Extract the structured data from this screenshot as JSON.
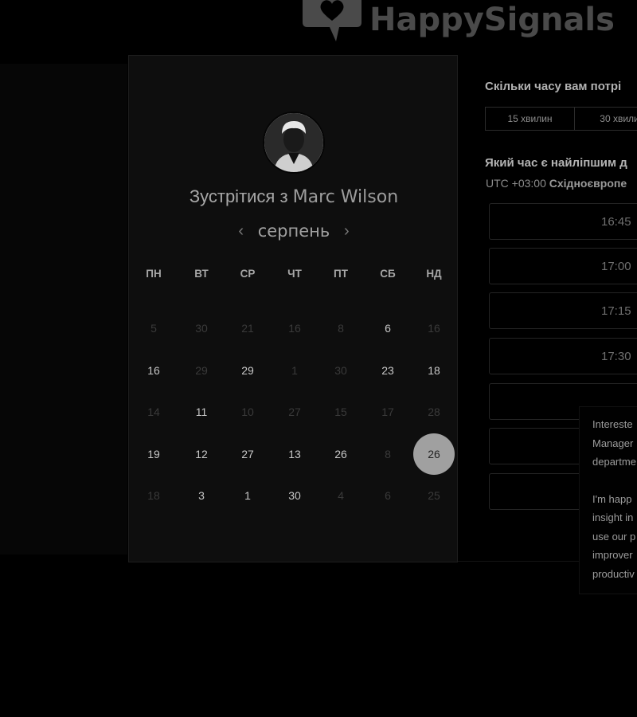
{
  "header": {
    "logo_text": "HappySignals"
  },
  "calendar": {
    "meet_prefix": "Зустрітися з ",
    "meet_name": "Marc Wilson",
    "month": "серпень",
    "weekdays": [
      "ПН",
      "ВТ",
      "СР",
      "ЧТ",
      "ПТ",
      "СБ",
      "НД"
    ],
    "weeks": [
      [
        {
          "d": "5",
          "s": "dim"
        },
        {
          "d": "30",
          "s": "dim"
        },
        {
          "d": "21",
          "s": "dim"
        },
        {
          "d": "16",
          "s": "dim"
        },
        {
          "d": "8",
          "s": "dim"
        },
        {
          "d": "6",
          "s": "on"
        },
        {
          "d": "16",
          "s": "dim"
        }
      ],
      [
        {
          "d": "16",
          "s": "on"
        },
        {
          "d": "29",
          "s": "dim"
        },
        {
          "d": "29",
          "s": "on"
        },
        {
          "d": "1",
          "s": "dim"
        },
        {
          "d": "30",
          "s": "dim"
        },
        {
          "d": "23",
          "s": "on"
        },
        {
          "d": "18",
          "s": "on"
        }
      ],
      [
        {
          "d": "14",
          "s": "dim"
        },
        {
          "d": "11",
          "s": "on"
        },
        {
          "d": "10",
          "s": "dim"
        },
        {
          "d": "27",
          "s": "dim"
        },
        {
          "d": "15",
          "s": "dim"
        },
        {
          "d": "17",
          "s": "dim"
        },
        {
          "d": "28",
          "s": "dim"
        }
      ],
      [
        {
          "d": "19",
          "s": "on"
        },
        {
          "d": "12",
          "s": "on"
        },
        {
          "d": "27",
          "s": "on"
        },
        {
          "d": "13",
          "s": "on"
        },
        {
          "d": "26",
          "s": "on"
        },
        {
          "d": "8",
          "s": "dim"
        },
        {
          "d": "26",
          "s": "sel"
        }
      ],
      [
        {
          "d": "18",
          "s": "dim"
        },
        {
          "d": "3",
          "s": "on"
        },
        {
          "d": "1",
          "s": "on"
        },
        {
          "d": "30",
          "s": "on"
        },
        {
          "d": "4",
          "s": "dim"
        },
        {
          "d": "6",
          "s": "dim"
        },
        {
          "d": "25",
          "s": "dim"
        }
      ]
    ]
  },
  "booking": {
    "duration_question": "Скільки часу вам потрі",
    "durations": [
      "15 хвилин",
      "30 хвили"
    ],
    "time_question": "Який час є найліпшим д",
    "timezone_prefix": "UTC +03:00 ",
    "timezone_name": "Східноєвропе",
    "slots": [
      "16:45",
      "17:00",
      "17:15",
      "17:30",
      "",
      "",
      ""
    ]
  },
  "promo": {
    "lines_1": [
      "Intereste",
      "Manager",
      "departme"
    ],
    "lines_2": [
      "I'm happ",
      "insight in",
      "use our p",
      "improver",
      "productiv"
    ]
  },
  "colors": {
    "selected_day": "#a0a0a0",
    "background": "#000000"
  }
}
